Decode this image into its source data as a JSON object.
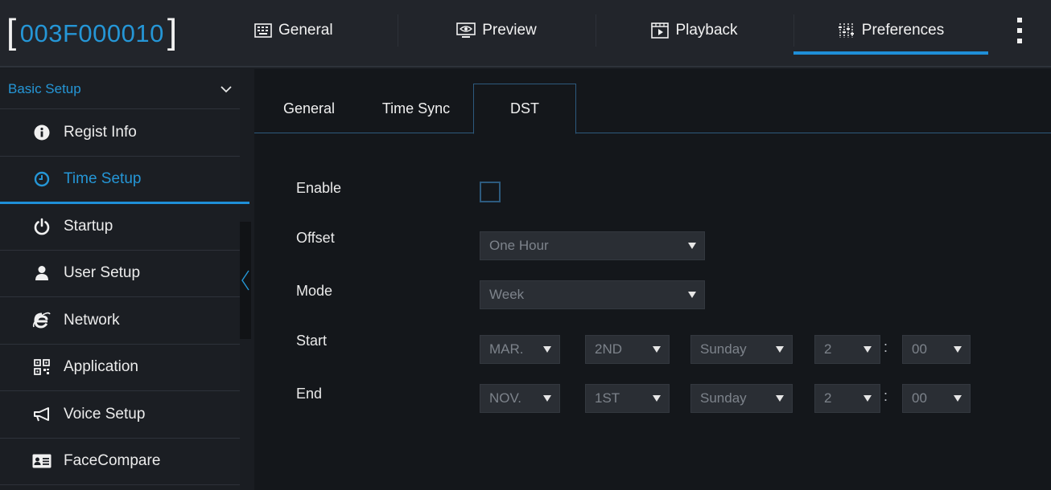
{
  "header": {
    "device_id": "003F000010",
    "bracket_open": "[",
    "bracket_close": "]",
    "tabs": [
      {
        "label": "General",
        "icon": "keyboard-icon"
      },
      {
        "label": "Preview",
        "icon": "monitor-eye-icon"
      },
      {
        "label": "Playback",
        "icon": "film-play-icon"
      },
      {
        "label": "Preferences",
        "icon": "sliders-icon",
        "active": true
      }
    ],
    "more_icon": "kebab-menu-icon"
  },
  "sidebar": {
    "section_title": "Basic Setup",
    "items": [
      {
        "label": "Regist Info",
        "icon": "info-icon"
      },
      {
        "label": "Time Setup",
        "icon": "clock-icon",
        "active": true
      },
      {
        "label": "Startup",
        "icon": "power-icon"
      },
      {
        "label": "User Setup",
        "icon": "user-icon"
      },
      {
        "label": "Network",
        "icon": "internet-explorer-icon"
      },
      {
        "label": "Application",
        "icon": "qr-code-icon"
      },
      {
        "label": "Voice Setup",
        "icon": "megaphone-icon"
      },
      {
        "label": "FaceCompare",
        "icon": "id-card-icon"
      }
    ]
  },
  "subtabs": [
    "General",
    "Time Sync",
    "DST"
  ],
  "active_subtab": "DST",
  "form": {
    "enable_label": "Enable",
    "enable_checked": false,
    "offset_label": "Offset",
    "offset_value": "One Hour",
    "mode_label": "Mode",
    "mode_value": "Week",
    "start_label": "Start",
    "start": {
      "month": "MAR.",
      "week": "2ND",
      "day": "Sunday",
      "hour": "2",
      "minute": "00"
    },
    "end_label": "End",
    "end": {
      "month": "NOV.",
      "week": "1ST",
      "day": "Sunday",
      "hour": "2",
      "minute": "00"
    },
    "time_separator": ":"
  },
  "colors": {
    "accent": "#1f8fd8",
    "background": "#14171b",
    "sidebar": "#1b1e23",
    "topbar": "#22252b"
  }
}
